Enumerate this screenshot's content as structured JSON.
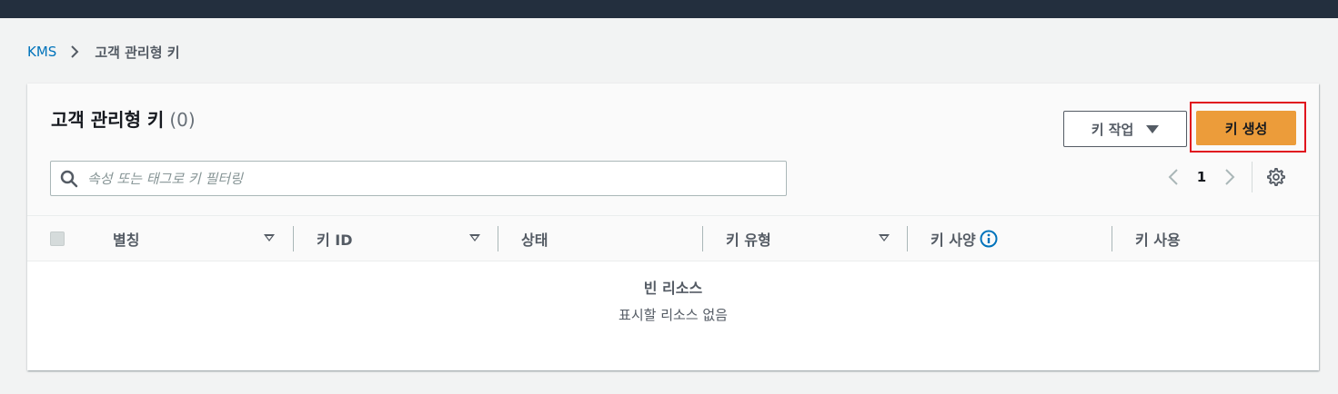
{
  "breadcrumb": {
    "root": "KMS",
    "current": "고객 관리형 키"
  },
  "panel": {
    "title": "고객 관리형 키",
    "count": "(0)",
    "actions_label": "키 작업",
    "create_label": "키 생성",
    "search_placeholder": "속성 또는 태그로 키 필터링",
    "page_number": "1"
  },
  "table": {
    "columns": {
      "alias": "별칭",
      "key_id": "키 ID",
      "status": "상태",
      "key_type": "키 유형",
      "key_spec": "키 사양",
      "key_usage": "키 사용"
    },
    "empty_title": "빈 리소스",
    "empty_desc": "표시할 리소스 없음"
  },
  "colors": {
    "topbar": "#232f3e",
    "link": "#0073bb",
    "primary_button": "#ec9c3a",
    "highlight_border": "#e0141e"
  },
  "icons": [
    "chevron-right-icon",
    "caret-down-icon",
    "search-icon",
    "chevron-left-icon",
    "gear-icon",
    "info-icon",
    "sort-caret-icon"
  ]
}
